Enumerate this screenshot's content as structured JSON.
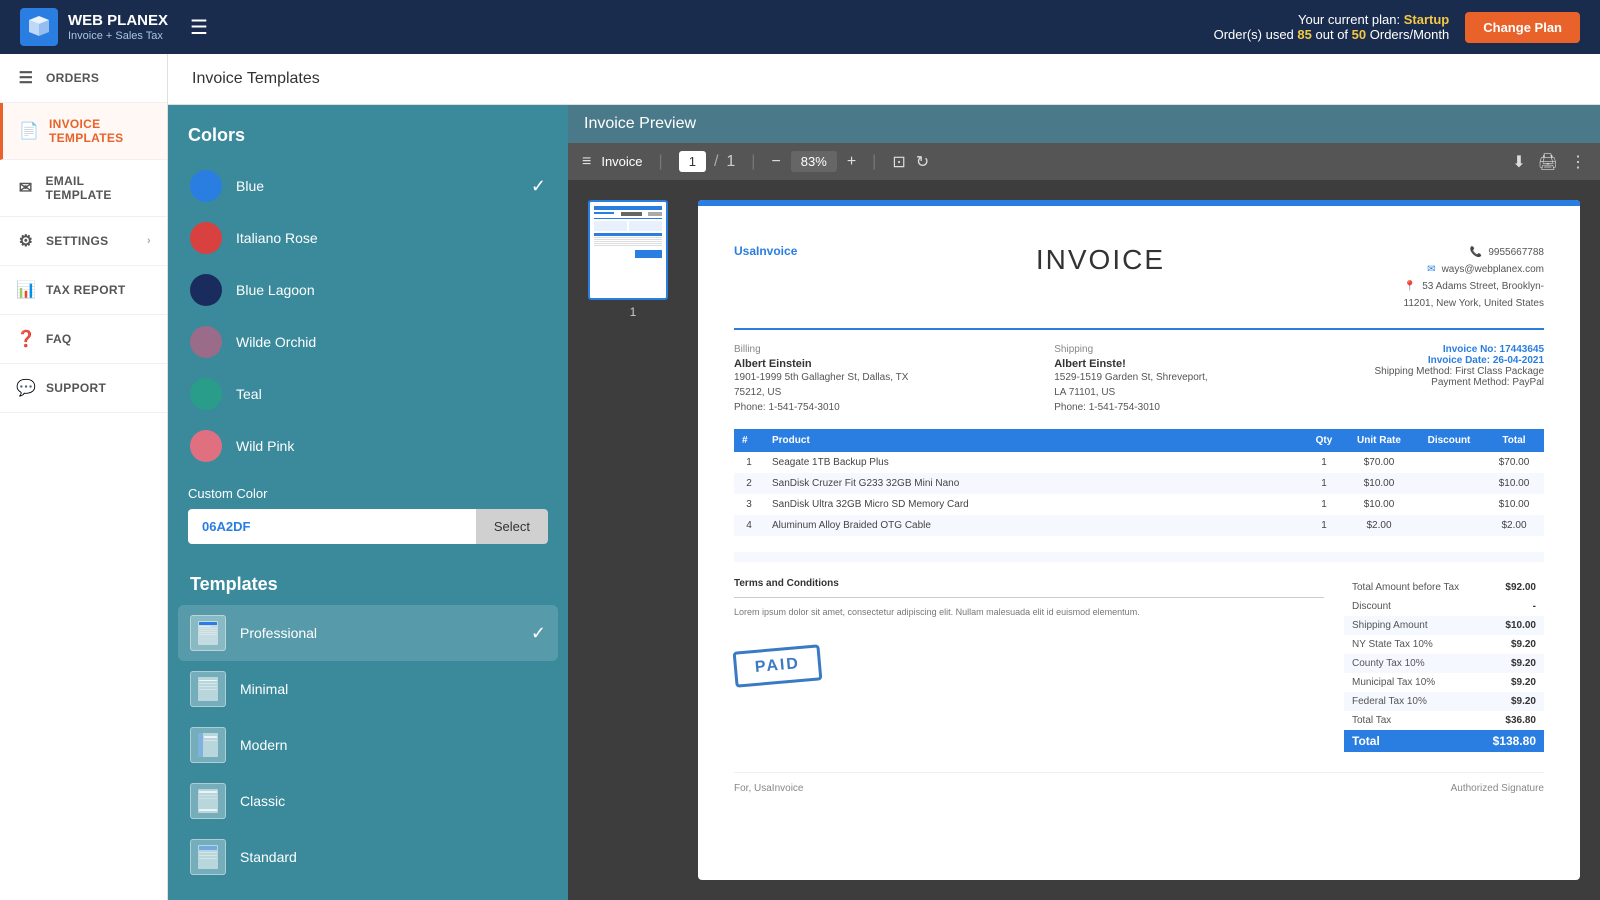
{
  "topbar": {
    "logo_line1": "WEB PLANEX",
    "logo_line2": "Invoice + Sales Tax",
    "plan_label": "Your current plan:",
    "plan_name": "Startup",
    "orders_label": "Order(s) used",
    "orders_used": "85",
    "orders_out": "out of",
    "orders_limit": "50",
    "orders_period": "Orders/Month",
    "change_plan_label": "Change Plan"
  },
  "sidebar": {
    "items": [
      {
        "id": "orders",
        "label": "ORDERS",
        "icon": "☰"
      },
      {
        "id": "invoice-templates",
        "label": "INVOICE TEMPLATES",
        "icon": "📄",
        "active": true
      },
      {
        "id": "email-template",
        "label": "EMAIL TEMPLATE",
        "icon": "✉"
      },
      {
        "id": "settings",
        "label": "SETTINGS",
        "icon": "⚙",
        "has_arrow": true
      },
      {
        "id": "tax-report",
        "label": "TAX REPORT",
        "icon": "📊"
      },
      {
        "id": "faq",
        "label": "FAQ",
        "icon": "❓"
      },
      {
        "id": "support",
        "label": "SUPPORT",
        "icon": "💬"
      }
    ]
  },
  "page_title": "Invoice Templates",
  "left_panel": {
    "colors_title": "Colors",
    "colors": [
      {
        "name": "Blue",
        "hex": "#2a7de1",
        "active": true
      },
      {
        "name": "Italiano Rose",
        "hex": "#d94040"
      },
      {
        "name": "Blue Lagoon",
        "hex": "#1a2c5e"
      },
      {
        "name": "Wilde Orchid",
        "hex": "#9b6b8a"
      },
      {
        "name": "Teal",
        "hex": "#2a9d8a"
      },
      {
        "name": "Wild Pink",
        "hex": "#e07080"
      }
    ],
    "custom_color_label": "Custom Color",
    "custom_color_value": "06A2DF",
    "select_btn_label": "Select",
    "templates_title": "Templates",
    "templates": [
      {
        "name": "Professional",
        "active": true
      },
      {
        "name": "Minimal"
      },
      {
        "name": "Modern"
      },
      {
        "name": "Classic"
      },
      {
        "name": "Standard"
      }
    ]
  },
  "preview": {
    "title": "Invoice Preview",
    "toolbar_icon": "≡",
    "label": "Invoice",
    "page_current": "1",
    "page_total": "1",
    "zoom": "83%",
    "thumb_page_num": "1"
  },
  "invoice": {
    "company_name": "UsaInvoice",
    "title": "INVOICE",
    "phone": "9955667788",
    "email": "ways@webplanex.com",
    "address": "11201, New York, United States",
    "street": "53 Adams Street, Brooklyn-",
    "billing_label": "Billing",
    "billing_name": "Albert Einstein",
    "billing_addr1": "1901-1999 5th Gallagher St, Dallas, TX",
    "billing_addr2": "75212, US",
    "billing_phone": "Phone: 1-541-754-3010",
    "shipping_label": "Shipping",
    "shipping_name": "Albert Einste!",
    "shipping_addr1": "1529-1519 Garden St, Shreveport,",
    "shipping_addr2": "LA 71101, US",
    "shipping_phone": "Phone: 1-541-754-3010",
    "invoice_no_label": "Invoice No:",
    "invoice_no": "17443645",
    "invoice_date_label": "Invoice Date:",
    "invoice_date": "26-04-2021",
    "shipping_method_label": "Shipping Method:",
    "shipping_method": "First Class Package",
    "payment_method_label": "Payment Method:",
    "payment_method": "PayPal",
    "table_headers": [
      "#",
      "Product",
      "Qty",
      "Unit Rate",
      "Discount",
      "Total"
    ],
    "table_rows": [
      {
        "num": "1",
        "product": "Seagate 1TB Backup Plus",
        "qty": "1",
        "unit_rate": "$70.00",
        "discount": "",
        "total": "$70.00"
      },
      {
        "num": "2",
        "product": "SanDisk Cruzer Fit G233 32GB Mini Nano",
        "qty": "1",
        "unit_rate": "$10.00",
        "discount": "",
        "total": "$10.00"
      },
      {
        "num": "3",
        "product": "SanDisk Ultra 32GB Micro SD Memory Card",
        "qty": "1",
        "unit_rate": "$10.00",
        "discount": "",
        "total": "$10.00"
      },
      {
        "num": "4",
        "product": "Aluminum Alloy Braided OTG Cable",
        "qty": "1",
        "unit_rate": "$2.00",
        "discount": "",
        "total": "$2.00"
      }
    ],
    "terms_title": "Terms and Conditions",
    "terms_text": "Lorem ipsum dolor sit amet, consectetur adipiscing elit. Nullam malesuada elit id euismod elementum.",
    "paid_stamp": "PAID",
    "total_before_tax_label": "Total Amount before Tax",
    "total_before_tax": "$92.00",
    "discount_label": "Discount",
    "discount_value": "-",
    "shipping_label2": "Shipping Amount",
    "shipping_value": "$10.00",
    "ny_state_label": "NY State Tax 10%",
    "ny_state_value": "$9.20",
    "county_label": "County Tax 10%",
    "county_value": "$9.20",
    "municipal_label": "Municipal Tax 10%",
    "municipal_value": "$9.20",
    "federal_label": "Federal Tax 10%",
    "federal_value": "$9.20",
    "total_tax_label": "Total Tax",
    "total_tax_value": "$36.80",
    "total_label": "Total",
    "total_value": "$138.80",
    "footer_for": "For, UsaInvoice",
    "footer_sig": "Authorized Signature"
  }
}
